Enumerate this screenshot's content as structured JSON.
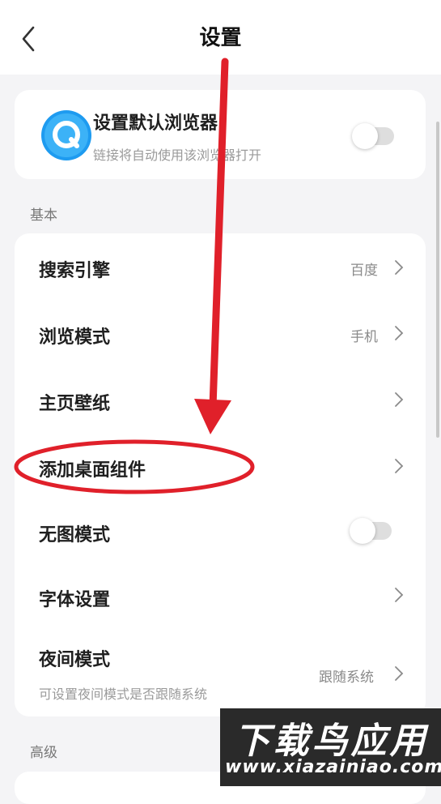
{
  "header": {
    "title": "设置",
    "back_icon": "chevron-left-icon"
  },
  "default_browser": {
    "title": "设置默认浏览器",
    "subtitle": "链接将自动使用该浏览器打开",
    "icon": "browser-q-icon",
    "icon_color": "#1e9bf0",
    "toggle_on": false
  },
  "sections": {
    "basic": "基本",
    "advanced": "高级"
  },
  "basic_rows": [
    {
      "label": "搜索引擎",
      "value": "百度"
    },
    {
      "label": "浏览模式",
      "value": "手机"
    },
    {
      "label": "主页壁纸",
      "value": ""
    },
    {
      "label": "添加桌面组件",
      "value": ""
    },
    {
      "label": "无图模式",
      "toggle_on": false
    },
    {
      "label": "字体设置",
      "value": ""
    },
    {
      "label": "夜间模式",
      "value": "跟随系统",
      "subtitle": "可设置夜间模式是否跟随系统"
    }
  ],
  "annotation": {
    "color": "#e0202a",
    "arrow": "arrow-down-icon",
    "highlight": "ellipse-highlight"
  },
  "watermark": {
    "title": "下载鸟应用",
    "url": "www.xiazainiao.com"
  }
}
